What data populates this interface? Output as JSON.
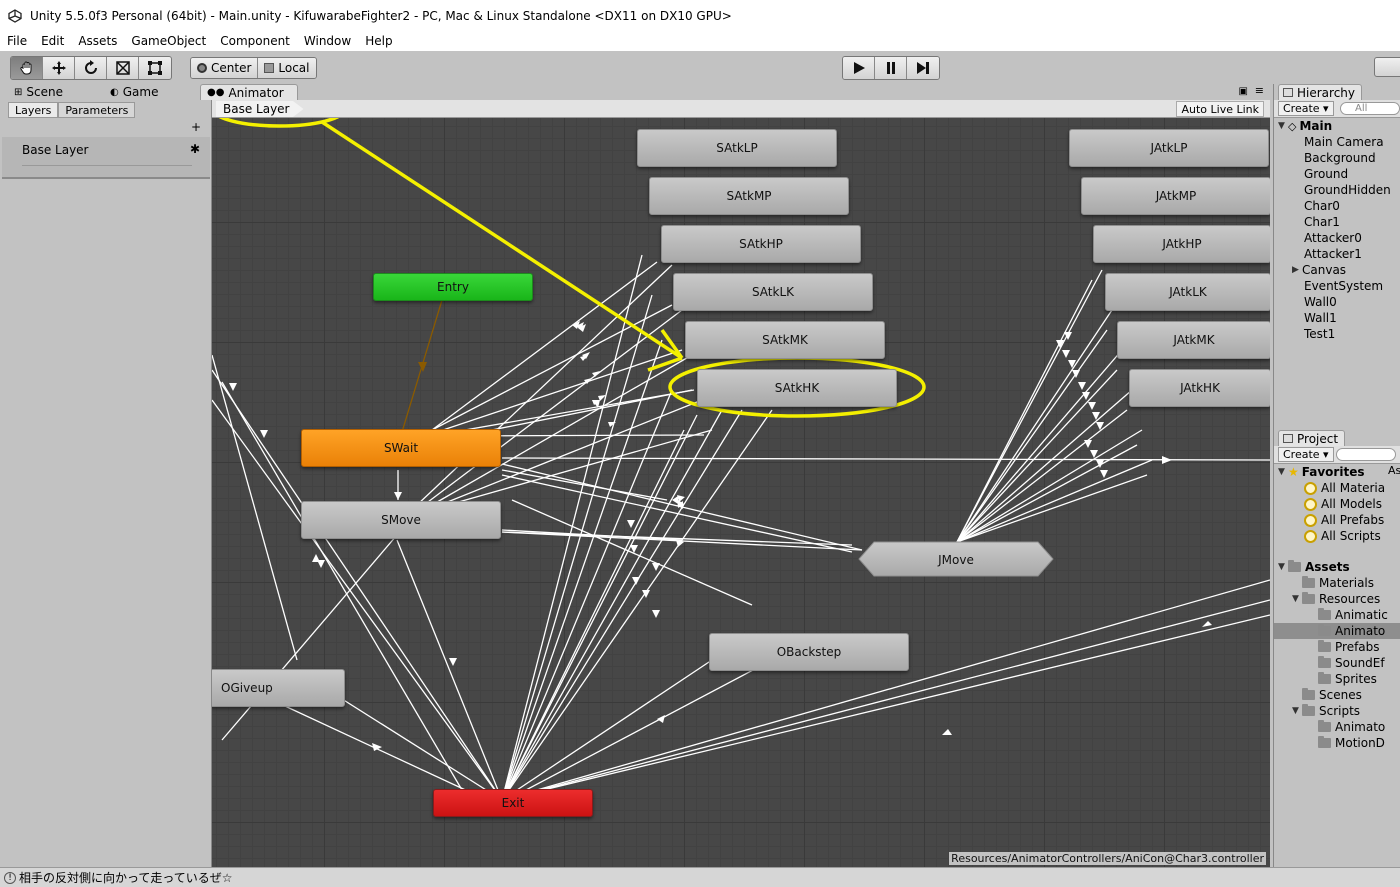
{
  "window": {
    "title": "Unity 5.5.0f3 Personal (64bit) - Main.unity - KifuwarabeFighter2 - PC, Mac & Linux Standalone <DX11 on DX10 GPU>"
  },
  "menu": [
    "File",
    "Edit",
    "Assets",
    "GameObject",
    "Component",
    "Window",
    "Help"
  ],
  "toolbar": {
    "pivot_center": "Center",
    "pivot_local": "Local"
  },
  "tabs": {
    "scene": "Scene",
    "game": "Game",
    "animator": "Animator"
  },
  "left_panel": {
    "tabs": [
      "Layers",
      "Parameters"
    ],
    "plus": "+",
    "layers": [
      {
        "name": "Base Layer"
      }
    ]
  },
  "graph": {
    "breadcrumb": "Base Layer",
    "auto_live_link": "Auto Live Link",
    "path": "Resources/AnimatorControllers/AniCon@Char3.controller",
    "nodes": {
      "entry": "Entry",
      "exit": "Exit",
      "swait": "SWait",
      "smove": "SMove",
      "jmove": "JMove",
      "obackstep": "OBackstep",
      "ogiveup": "OGiveup",
      "satklp": "SAtkLP",
      "satkmp": "SAtkMP",
      "satkhp": "SAtkHP",
      "satklk": "SAtkLK",
      "satkmk": "SAtkMK",
      "satkhk": "SAtkHK",
      "jatklp": "JAtkLP",
      "jatkmp": "JAtkMP",
      "jatkhp": "JAtkHP",
      "jatklk": "JAtkLK",
      "jatkmk": "JAtkMK",
      "jatkhk": "JAtkHK"
    },
    "highlight_color": "#f4f000"
  },
  "hierarchy": {
    "tab": "Hierarchy",
    "create": "Create ▾",
    "search_placeholder": "All",
    "root": "Main",
    "items": [
      "Main Camera",
      "Background",
      "Ground",
      "GroundHidden",
      "Char0",
      "Char1",
      "Attacker0",
      "Attacker1",
      "Canvas",
      "EventSystem",
      "Wall0",
      "Wall1",
      "Test1"
    ]
  },
  "project": {
    "tab": "Project",
    "create": "Create ▾",
    "favorites": "Favorites",
    "fav_items": [
      "All Materia",
      "All Models",
      "All Prefabs",
      "All Scripts"
    ],
    "assets": "Assets",
    "asset_items": [
      "Materials",
      "Resources",
      "Animatic",
      "Animato",
      "Prefabs",
      "SoundEf",
      "Sprites",
      "Scenes",
      "Scripts",
      "Animato",
      "MotionD"
    ],
    "side_label": "As"
  },
  "status": {
    "message": "相手の反対側に向かって走っているぜ☆"
  }
}
